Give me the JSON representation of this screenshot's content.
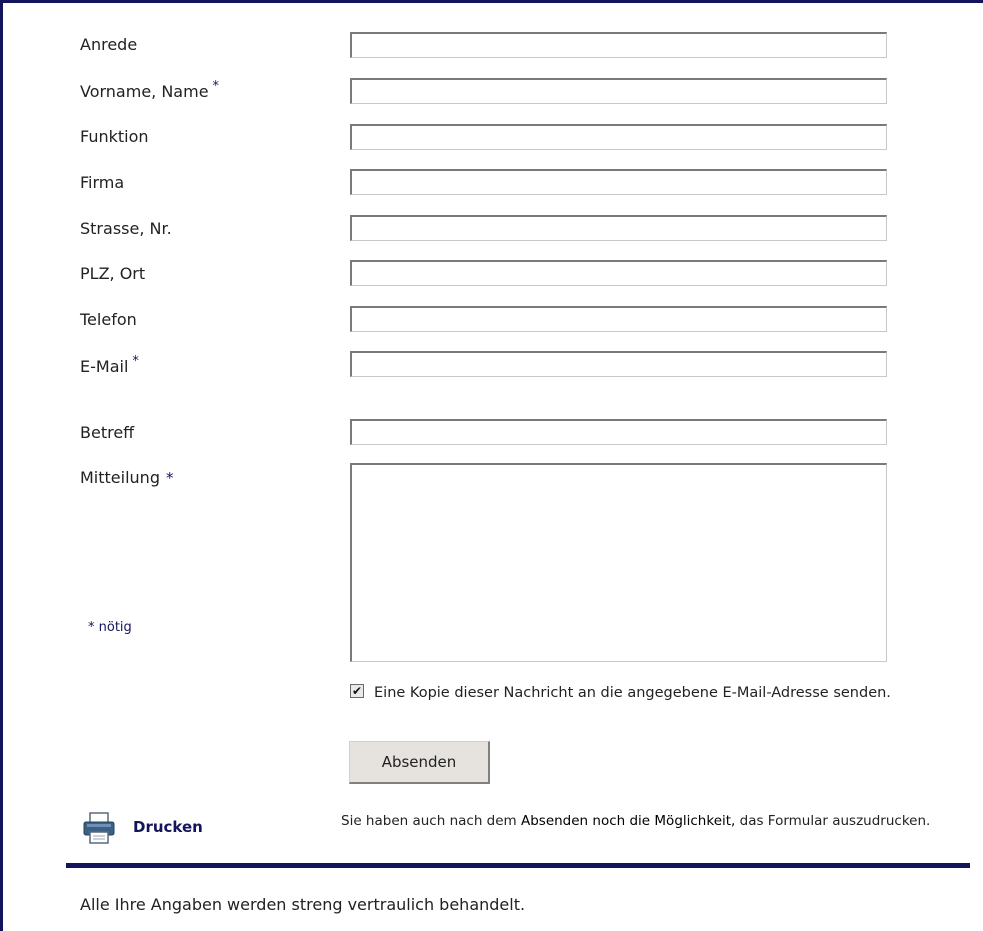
{
  "form": {
    "fields": [
      {
        "key": "anrede",
        "label": "Anrede",
        "required": false,
        "value": ""
      },
      {
        "key": "name",
        "label": "Vorname, Name",
        "required": true,
        "value": ""
      },
      {
        "key": "funktion",
        "label": "Funktion",
        "required": false,
        "value": ""
      },
      {
        "key": "firma",
        "label": "Firma",
        "required": false,
        "value": ""
      },
      {
        "key": "strasse",
        "label": "Strasse, Nr.",
        "required": false,
        "value": ""
      },
      {
        "key": "plz",
        "label": "PLZ, Ort",
        "required": false,
        "value": ""
      },
      {
        "key": "telefon",
        "label": "Telefon",
        "required": false,
        "value": ""
      },
      {
        "key": "email",
        "label": "E-Mail",
        "required": true,
        "value": ""
      },
      {
        "key": "betreff",
        "label": "Betreff",
        "required": false,
        "value": ""
      },
      {
        "key": "mitteilung",
        "label": "Mitteilung",
        "required": true,
        "value": ""
      }
    ],
    "required_marker": "*",
    "required_note": "* nötig",
    "copy_checkbox_checked": true,
    "copy_text": "Eine Kopie dieser Nachricht an die angegebene E-Mail-Adresse senden.",
    "submit_label": "Absenden"
  },
  "print": {
    "icon": "printer-icon",
    "link_label": "Drucken",
    "note_prefix": "Sie haben auch nach dem ",
    "note_highlight": "Absenden noch die Möglichkeit,",
    "note_suffix": " das Formular auszudrucken."
  },
  "footer": {
    "privacy_text": "Alle Ihre Angaben werden streng vertraulich behandelt."
  },
  "colors": {
    "accent": "#14145c"
  }
}
